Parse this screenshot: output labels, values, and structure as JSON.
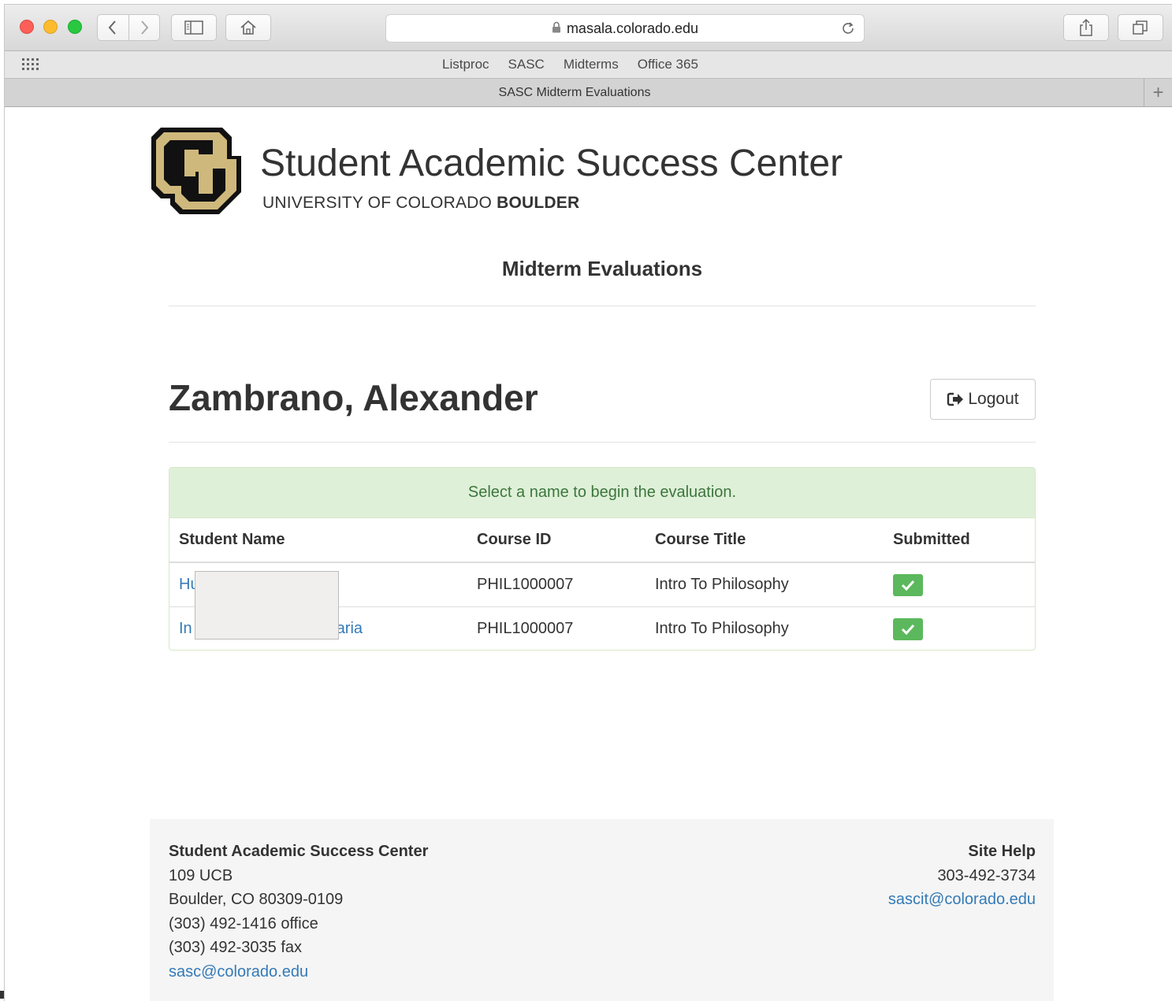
{
  "browser": {
    "url": "masala.colorado.edu",
    "favorites": [
      "Listproc",
      "SASC",
      "Midterms",
      "Office 365"
    ],
    "tab_title": "SASC Midterm Evaluations",
    "new_tab_label": "+"
  },
  "header": {
    "org_name": "Student Academic Success Center",
    "university_prefix": "UNIVERSITY OF COLORADO ",
    "university_bold": "BOULDER",
    "app_title": "Midterm Evaluations"
  },
  "user": {
    "name": "Zambrano, Alexander",
    "logout_label": "Logout"
  },
  "panel": {
    "message": "Select a name to begin the evaluation.",
    "columns": [
      "Student Name",
      "Course ID",
      "Course Title",
      "Submitted"
    ],
    "rows": [
      {
        "student_visible_start": "Hu",
        "student_visible_end": "",
        "course_id": "PHIL1000007",
        "course_title": "Intro To Philosophy",
        "submitted": true
      },
      {
        "student_visible_start": "In",
        "student_visible_end": "aria",
        "course_id": "PHIL1000007",
        "course_title": "Intro To Philosophy",
        "submitted": true
      }
    ]
  },
  "footer": {
    "left": {
      "title": "Student Academic Success Center",
      "address1": "109 UCB",
      "address2": "Boulder, CO 80309-0109",
      "phone": "(303) 492-1416 office",
      "fax": "(303) 492-3035 fax",
      "email": "sasc@colorado.edu"
    },
    "right": {
      "title": "Site Help",
      "phone": "303-492-3734",
      "email": "sascit@colorado.edu"
    }
  },
  "colors": {
    "success_bg": "#dff0d8",
    "success_text": "#3c763d",
    "link": "#337ab7",
    "check_bg": "#5cb85c",
    "cu_gold": "#cfb87c"
  }
}
